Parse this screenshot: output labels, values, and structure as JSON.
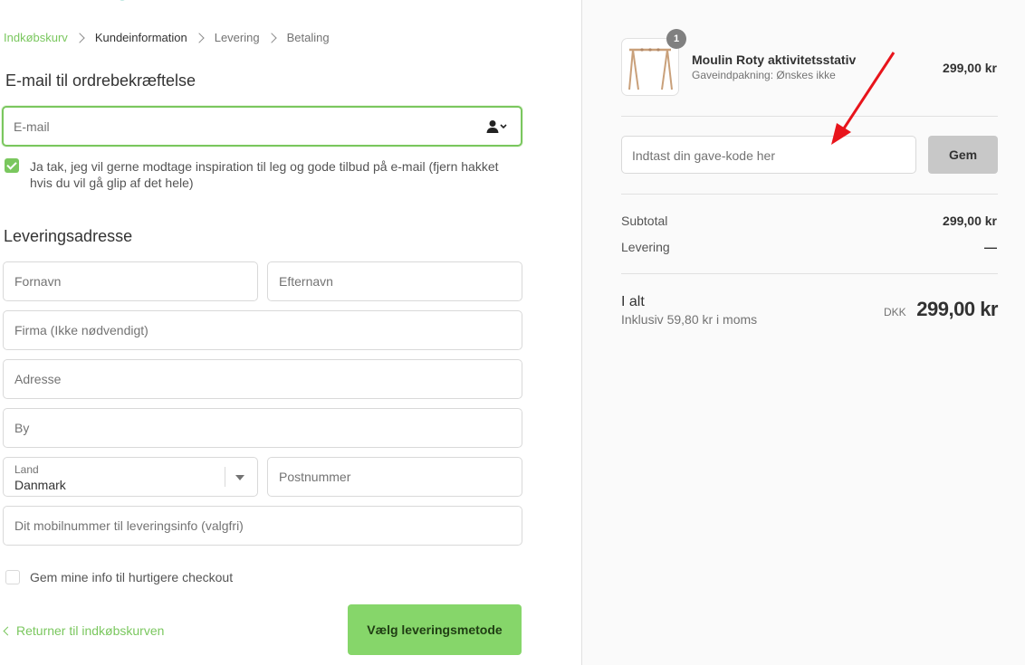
{
  "breadcrumb": {
    "cart": "Indkøbskurv",
    "customer_info": "Kundeinformation",
    "shipping": "Levering",
    "payment": "Betaling"
  },
  "contact": {
    "title": "E-mail til ordrebekræftelse",
    "email_placeholder": "E-mail",
    "newsletter_text": "Ja tak, jeg vil gerne modtage inspiration til leg og gode tilbud på e-mail (fjern hakket hvis du vil gå glip af det hele)",
    "newsletter_checked": true
  },
  "shipping_address": {
    "title": "Leveringsadresse",
    "first_name_placeholder": "Fornavn",
    "last_name_placeholder": "Efternavn",
    "company_placeholder": "Firma (Ikke nødvendigt)",
    "address_placeholder": "Adresse",
    "city_placeholder": "By",
    "country_label": "Land",
    "country_value": "Danmark",
    "postal_placeholder": "Postnummer",
    "phone_placeholder": "Dit mobilnummer til leveringsinfo (valgfri)"
  },
  "save_info": {
    "text": "Gem mine info til hurtigere checkout",
    "checked": false
  },
  "actions": {
    "back_link": "Returner til indkøbskurven",
    "continue_button": "Vælg leveringsmetode"
  },
  "order_summary": {
    "product": {
      "quantity": "1",
      "name": "Moulin Roty aktivitetsstativ",
      "variant": "Gaveindpakning: Ønskes ikke",
      "price": "299,00 kr"
    },
    "gift_code": {
      "placeholder": "Indtast din gave-kode her",
      "button": "Gem"
    },
    "subtotal_label": "Subtotal",
    "subtotal_value": "299,00 kr",
    "shipping_label": "Levering",
    "shipping_value": "—",
    "total_label": "I alt",
    "tax_note": "Inklusiv 59,80 kr i moms",
    "currency": "DKK",
    "total_value": "299,00 kr"
  },
  "colors": {
    "accent": "#7ac75e",
    "button": "#86d66a",
    "annotation_arrow": "#e8141b"
  }
}
